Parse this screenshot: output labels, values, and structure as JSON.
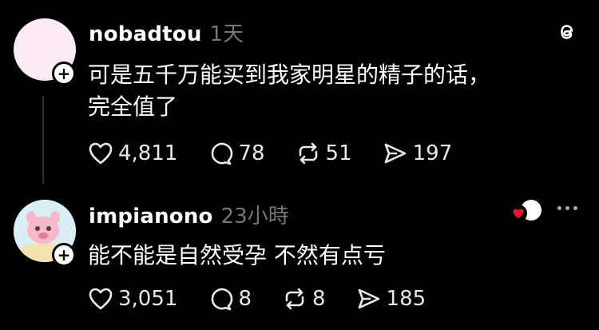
{
  "posts": [
    {
      "username": "nobadtou",
      "time": "1天",
      "text_lines": [
        "可是五千万能买到我家明星的精子的话，",
        "完全值了"
      ],
      "likes": "4,811",
      "comments": "78",
      "reposts": "51",
      "shares": "197"
    },
    {
      "username": "impianono",
      "time": "23小時",
      "text_lines": [
        "能不能是自然受孕 不然有点亏"
      ],
      "likes": "3,051",
      "comments": "8",
      "reposts": "8",
      "shares": "185"
    }
  ],
  "icons": {
    "app_logo": "threads-icon",
    "follow": "plus-icon",
    "like": "heart-icon",
    "comment": "comment-icon",
    "repost": "repost-icon",
    "share": "share-icon",
    "more": "more-icon"
  },
  "colors": {
    "background": "#000000",
    "text": "#ffffff",
    "muted": "#777777",
    "avatar1": "#fbeaf3",
    "heart_badge": "#e0162b"
  }
}
